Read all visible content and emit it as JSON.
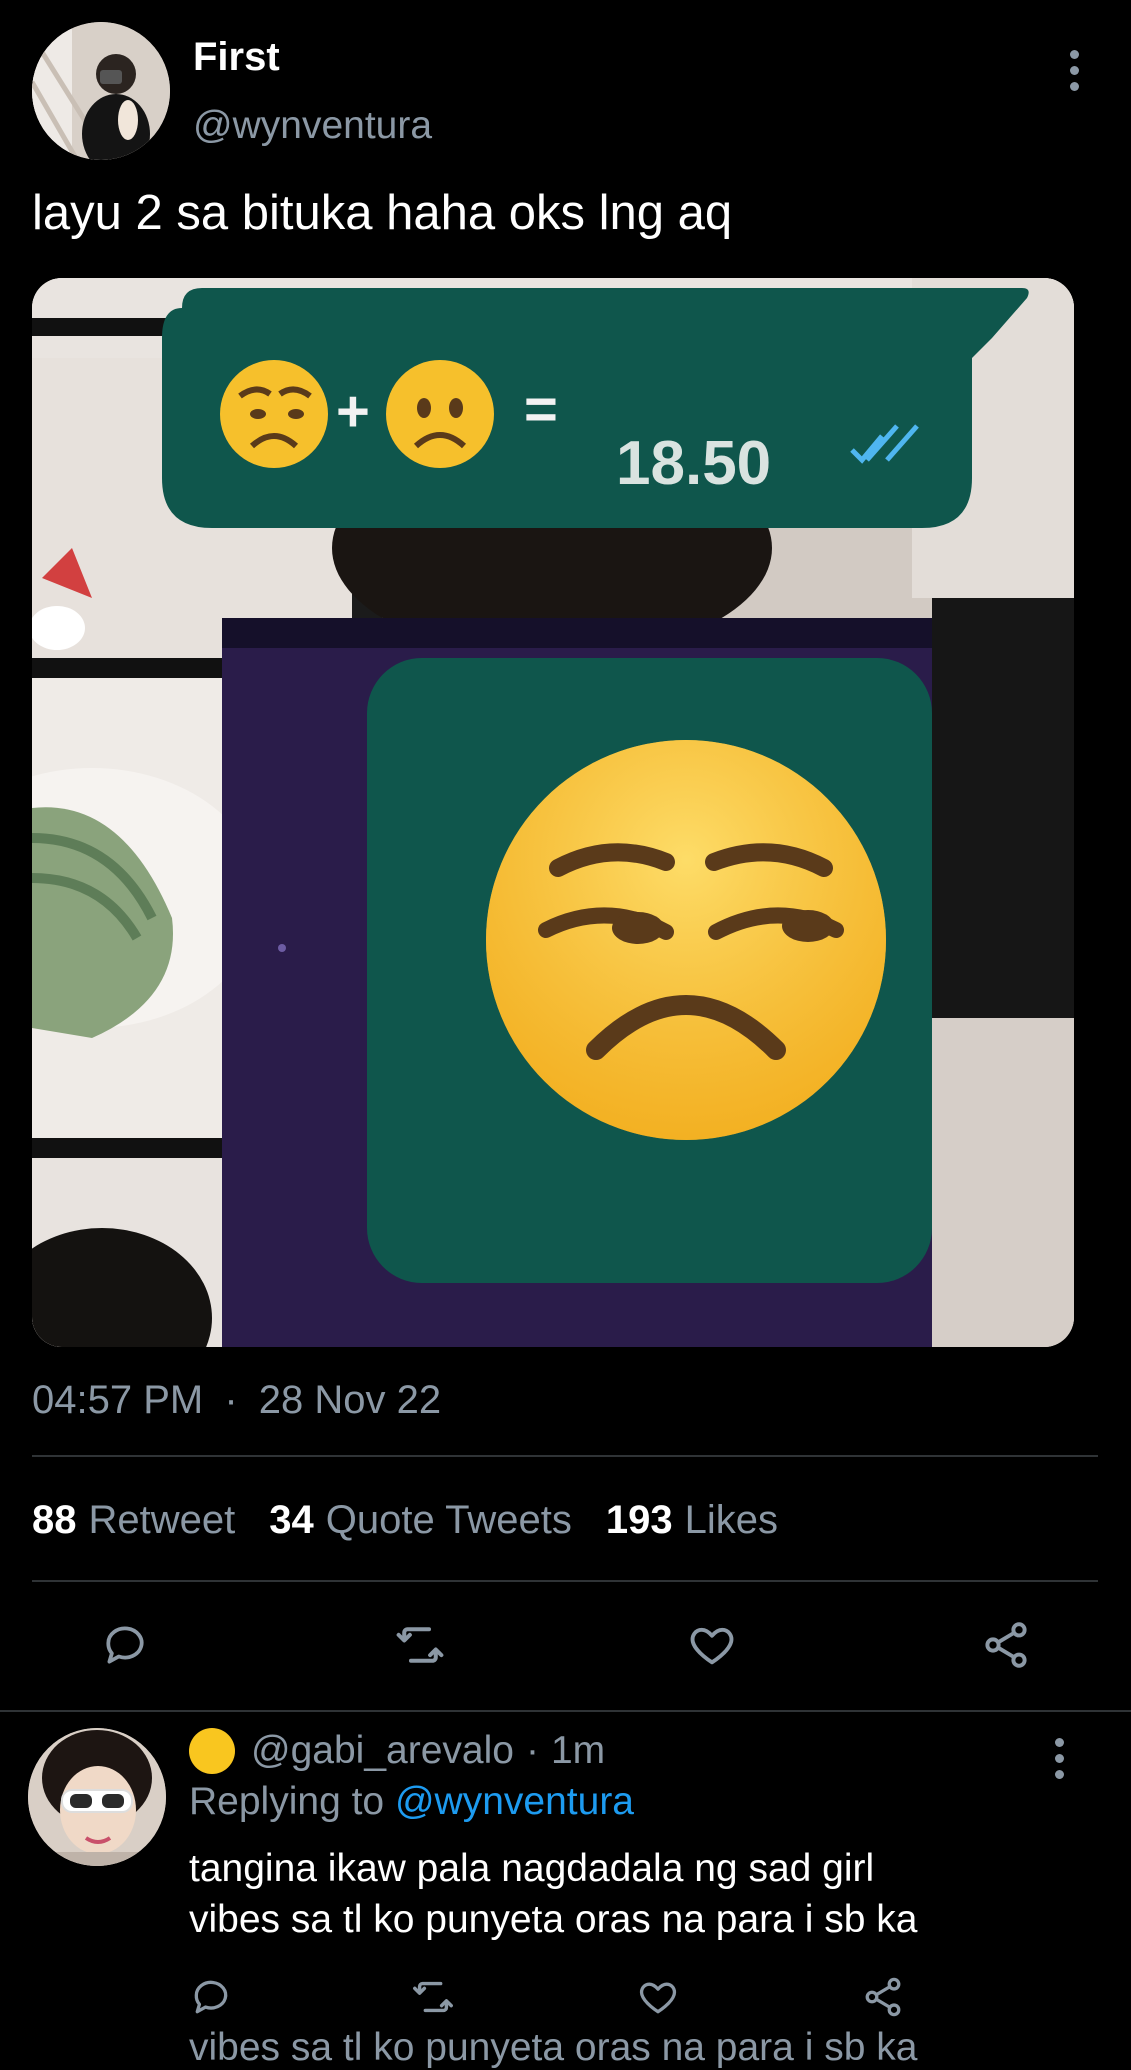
{
  "tweet": {
    "display_name": "First",
    "handle": "@wynventura",
    "text": "layu 2 sa bituka haha oks lng aq",
    "timestamp": "04:57 PM",
    "separator": "·",
    "date": "28 Nov 22",
    "media": {
      "bubble_price": "18.50",
      "bubble_plus": "+",
      "bubble_equals": "="
    },
    "stats": {
      "retweets_count": "88",
      "retweets_label": "Retweet",
      "quotes_count": "34",
      "quotes_label": "Quote Tweets",
      "likes_count": "193",
      "likes_label": "Likes"
    },
    "actions": [
      "reply-icon",
      "retweet-icon",
      "like-icon",
      "share-icon"
    ]
  },
  "reply": {
    "name_emoji": "yellow-circle-icon",
    "handle": "@gabi_arevalo",
    "separator": "·",
    "time": "1m",
    "replying_label": "Replying to",
    "replying_handle": "@wynventura",
    "text_line1": "tangina ikaw pala nagdadala ng sad girl",
    "text_line2": "vibes sa tl ko punyeta oras na para i sb ka"
  },
  "colors": {
    "background": "#000000",
    "muted": "#8b98a5",
    "link": "#1d9bf0",
    "bubble": "#0f564c",
    "divider": "#2f3336"
  }
}
